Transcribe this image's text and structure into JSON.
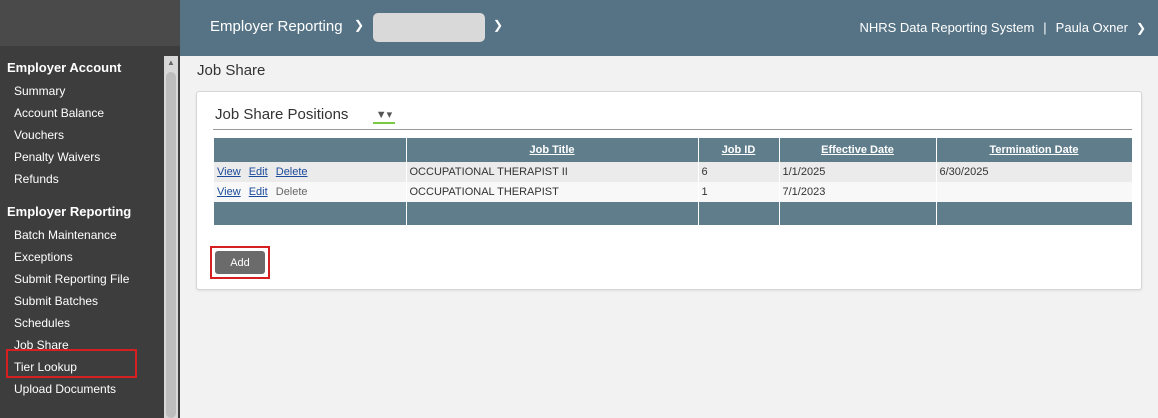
{
  "header": {
    "app_menu_label": "Employer Reporting",
    "employer_select_value": "",
    "system_name": "NHRS Data Reporting System",
    "separator": "|",
    "user_name": "Paula Oxner"
  },
  "sidebar": {
    "sections": [
      {
        "title": "Employer Account",
        "items": [
          "Summary",
          "Account Balance",
          "Vouchers",
          "Penalty Waivers",
          "Refunds"
        ]
      },
      {
        "title": "Employer Reporting",
        "items": [
          "Batch Maintenance",
          "Exceptions",
          "Submit Reporting File",
          "Submit Batches",
          "Schedules",
          "Job Share",
          "Tier Lookup",
          "Upload Documents"
        ]
      }
    ],
    "selected_item": "Job Share"
  },
  "page": {
    "title": "Job Share"
  },
  "panel": {
    "title": "Job Share Positions",
    "columns": [
      "",
      "Job Title",
      "Job ID",
      "Effective Date",
      "Termination Date"
    ],
    "rows": [
      {
        "actions": [
          "View",
          "Edit",
          "Delete"
        ],
        "delete_enabled": true,
        "job_title": "OCCUPATIONAL THERAPIST II",
        "job_id": "6",
        "effective_date": "1/1/2025",
        "termination_date": "6/30/2025"
      },
      {
        "actions": [
          "View",
          "Edit",
          "Delete"
        ],
        "delete_enabled": false,
        "job_title": "OCCUPATIONAL THERAPIST",
        "job_id": "1",
        "effective_date": "7/1/2023",
        "termination_date": ""
      }
    ],
    "add_label": "Add"
  },
  "icons": {
    "filter": "filter-icon",
    "chevron": "chevron-down-icon"
  },
  "colors": {
    "header_bg": "#557385",
    "grid_header_bg": "#607d8b",
    "sidebar_bg": "#3d3d3d",
    "highlight": "#d62020"
  }
}
